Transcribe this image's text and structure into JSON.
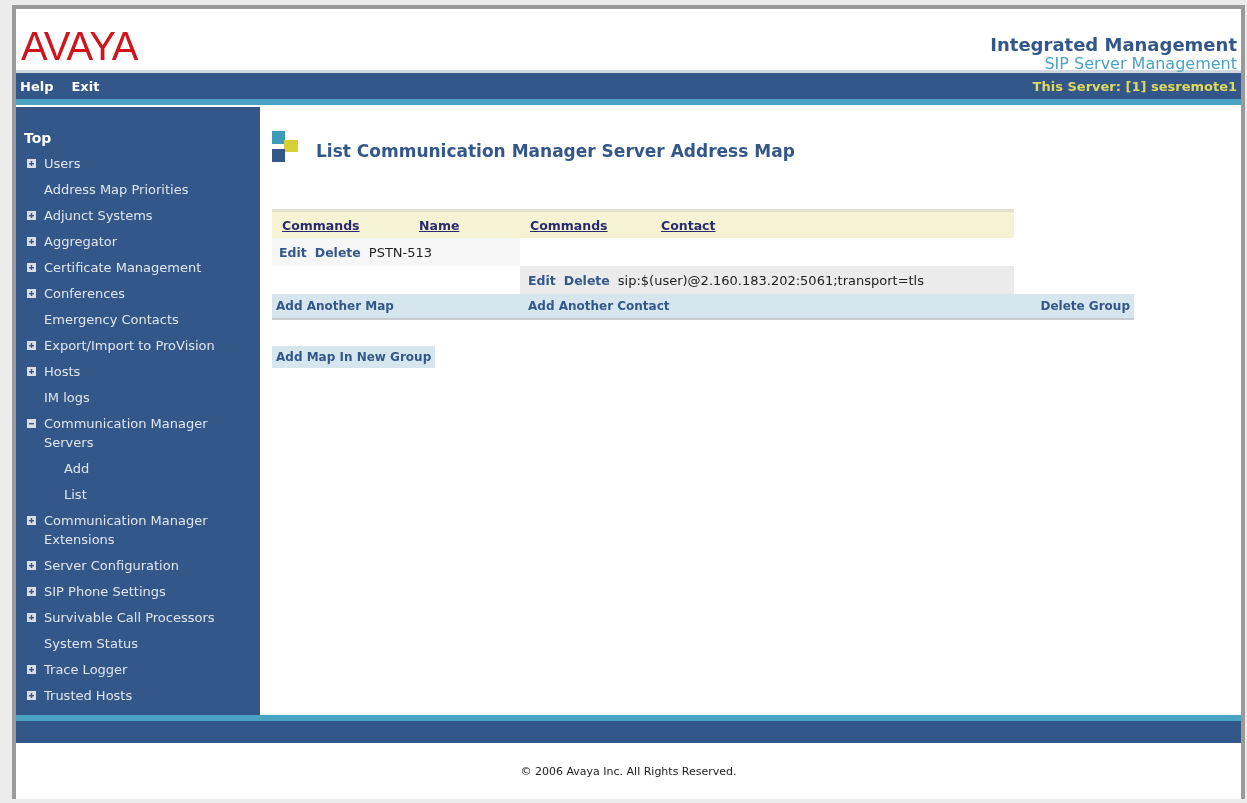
{
  "header": {
    "logo": "AVAYA",
    "title": "Integrated Management",
    "subtitle": "SIP Server Management"
  },
  "menu": [
    "Help",
    "Exit"
  ],
  "server": "This Server: [1] sesremote1",
  "sidebar": {
    "title": "Top",
    "items": [
      {
        "label": "Users",
        "kind": "group",
        "expanded": false
      },
      {
        "label": "Address Map Priorities",
        "kind": "link"
      },
      {
        "label": "Adjunct Systems",
        "kind": "group",
        "expanded": false
      },
      {
        "label": "Aggregator",
        "kind": "group",
        "expanded": false
      },
      {
        "label": "Certificate Management",
        "kind": "group",
        "expanded": false
      },
      {
        "label": "Conferences",
        "kind": "group",
        "expanded": false
      },
      {
        "label": "Emergency Contacts",
        "kind": "link"
      },
      {
        "label": "Export/Import to ProVision",
        "kind": "group",
        "expanded": false
      },
      {
        "label": "Hosts",
        "kind": "group",
        "expanded": false
      },
      {
        "label": "IM logs",
        "kind": "link"
      },
      {
        "label": "Communication Manager Servers",
        "kind": "group",
        "expanded": true,
        "children": [
          {
            "label": "Add"
          },
          {
            "label": "List"
          }
        ]
      },
      {
        "label": "Communication Manager Extensions",
        "kind": "group",
        "expanded": false
      },
      {
        "label": "Server Configuration",
        "kind": "group",
        "expanded": false
      },
      {
        "label": "SIP Phone Settings",
        "kind": "group",
        "expanded": false
      },
      {
        "label": "Survivable Call Processors",
        "kind": "group",
        "expanded": false
      },
      {
        "label": "System Status",
        "kind": "link"
      },
      {
        "label": "Trace Logger",
        "kind": "group",
        "expanded": false
      },
      {
        "label": "Trusted Hosts",
        "kind": "group",
        "expanded": false
      }
    ]
  },
  "page": {
    "title": "List Communication Manager Server Address Map",
    "columns": [
      "Commands",
      "Name",
      "Commands",
      "Contact"
    ],
    "maps": [
      {
        "commands": [
          "Edit",
          "Delete"
        ],
        "name": "PSTN-513",
        "contacts": [
          {
            "commands": [
              "Edit",
              "Delete"
            ],
            "contact": "sip:$(user)@2.160.183.202:5061;transport=tls"
          }
        ]
      }
    ],
    "group_actions": [
      "Add Another Map",
      "Add Another Contact",
      "Delete Group"
    ],
    "new_group": "Add Map In New Group"
  },
  "footer": "© 2006 Avaya Inc. All Rights Reserved."
}
